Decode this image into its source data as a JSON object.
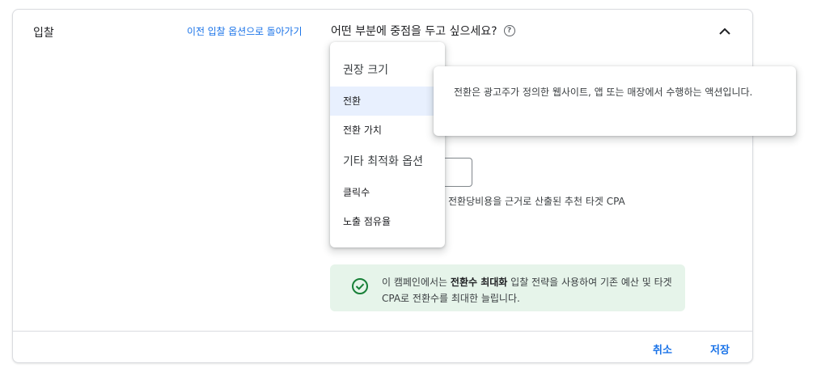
{
  "section": {
    "title": "입찰",
    "back_link": "이전 입찰 옵션으로 돌아가기",
    "question": "어떤 부분에 중점을 두고 싶으세요?",
    "help_glyph": "?"
  },
  "dropdown": {
    "heading_recommended": "권장 크기",
    "items_recommended": [
      "전환",
      "전환 가치"
    ],
    "heading_other": "기타 최적화 옵션",
    "items_other": [
      "클릭수",
      "노출 점유율"
    ],
    "selected": "전환"
  },
  "tooltip": {
    "text": "전환은 광고주가 정의한 웹사이트, 앱 또는 매장에서 수행하는 액션입니다."
  },
  "helper_text": "전환당비용을 근거로 산출된 추천 타겟 CPA",
  "info": {
    "prefix": "이 캠페인에서는 ",
    "bold": "전환수 최대화",
    "suffix": " 입찰 전략을 사용하여 기존 예산 및 타겟 CPA로 전환수를 최대한 늘립니다."
  },
  "footer": {
    "cancel_label": "취소",
    "save_label": "저장"
  },
  "colors": {
    "accent": "#1a73e8",
    "success": "#188038",
    "info_bg": "#e6f4ea",
    "selected_bg": "#e8f0fe"
  },
  "icons": {
    "collapse": "chevron-up-icon",
    "help": "help-circle-icon",
    "info": "check-circle-icon"
  }
}
